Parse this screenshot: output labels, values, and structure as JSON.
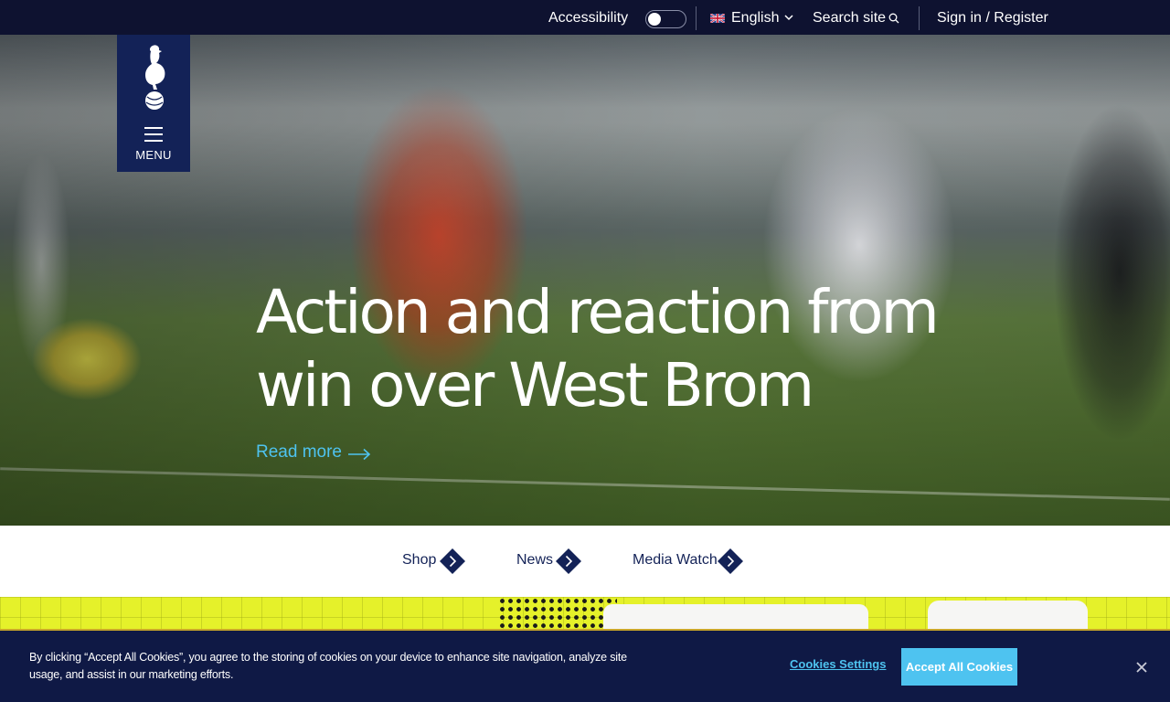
{
  "topbar": {
    "accessibility_label": "Accessibility",
    "accessibility_on": false,
    "language": "English",
    "search_label": "Search site",
    "signin_label": "Sign in / Register"
  },
  "nav": {
    "menu_label": "MENU"
  },
  "hero": {
    "headline": "Action and reaction from win over West Brom",
    "read_more": "Read more"
  },
  "quick_links": [
    {
      "label": "Shop"
    },
    {
      "label": "News"
    },
    {
      "label": "Media Watch"
    }
  ],
  "cookie_banner": {
    "text": "By clicking “Accept All Cookies”, you agree to the storing of cookies on your device to enhance site navigation, analyze site usage, and assist in our marketing efforts.",
    "settings_label": "Cookies Settings",
    "accept_label": "Accept All Cookies"
  },
  "icons": {
    "flag": "uk-flag-icon",
    "language_chevron": "chevron-down-icon",
    "search": "search-icon",
    "crest": "cockerel-logo",
    "menu": "hamburger-icon",
    "read_more": "arrow-right-icon",
    "quick_link": "chevron-right-diamond-icon",
    "close": "close-icon"
  },
  "colors": {
    "navy": "#132257",
    "topbar": "#0e1230",
    "accent": "#4ec3f0",
    "banner": "#0f1945",
    "promo_yellow": "#e5f12a"
  }
}
